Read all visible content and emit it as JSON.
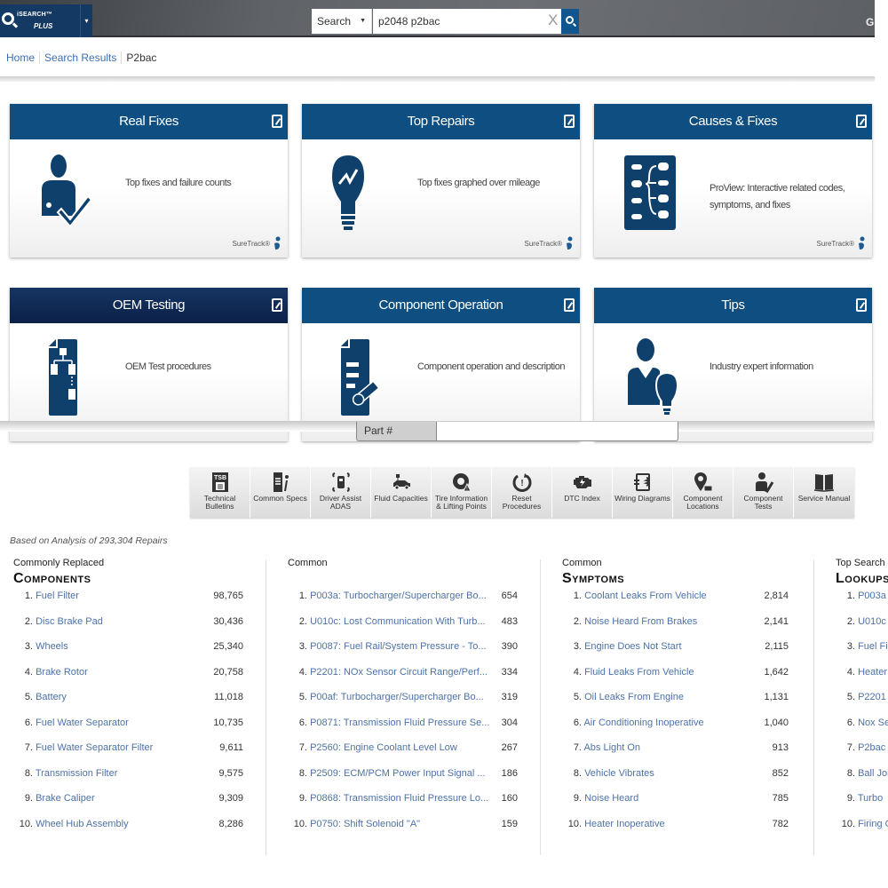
{
  "header": {
    "logo_line1": "iSEARCH™",
    "logo_line2": "PLUS",
    "search_type": "Search",
    "search_query": "p2048 p2bac",
    "clear_glyph": "X",
    "gear_partial": "G"
  },
  "breadcrumb": [
    {
      "label": "Home",
      "link": true
    },
    {
      "label": "Search Results",
      "link": true
    },
    {
      "label": "P2bac",
      "link": false
    }
  ],
  "tiles": [
    {
      "title": "Real Fixes",
      "description": "Top fixes and failure counts",
      "icon": "technician-checkmark-icon",
      "footer": "SureTrack®"
    },
    {
      "title": "Top Repairs",
      "description": "Top fixes graphed over mileage",
      "icon": "lightbulb-graph-icon",
      "footer": "SureTrack®"
    },
    {
      "title": "Causes & Fixes",
      "description": "ProView: Interactive related codes, symptoms, and fixes",
      "icon": "proview-tree-icon",
      "footer": "SureTrack®"
    },
    {
      "title": "OEM Testing",
      "description": "OEM Test procedures",
      "icon": "flowchart-document-icon",
      "footer": ""
    },
    {
      "title": "Component Operation",
      "description": "Component operation and description",
      "icon": "document-part-icon",
      "footer": ""
    },
    {
      "title": "Tips",
      "description": "Industry expert information",
      "icon": "expert-lightbulb-icon",
      "footer": ""
    }
  ],
  "part_search": {
    "label": "Part #",
    "value": ""
  },
  "toolbar": [
    {
      "label": "Technical Bulletins",
      "icon": "tsb-icon"
    },
    {
      "label": "Common Specs",
      "icon": "specs-icon"
    },
    {
      "label": "Driver Assist ADAS",
      "icon": "adas-icon"
    },
    {
      "label": "Fluid Capacities",
      "icon": "fluid-car-icon"
    },
    {
      "label": "Tire Information & Lifting Points",
      "icon": "tire-warning-icon"
    },
    {
      "label": "Reset Procedures",
      "icon": "reset-icon"
    },
    {
      "label": "DTC Index",
      "icon": "engine-icon"
    },
    {
      "label": "Wiring Diagrams",
      "icon": "wiring-icon"
    },
    {
      "label": "Component Locations",
      "icon": "location-pin-icon"
    },
    {
      "label": "Component Tests",
      "icon": "technician-test-icon"
    },
    {
      "label": "Service Manual",
      "icon": "book-icon"
    }
  ],
  "stats": {
    "analysis_text": "Based on Analysis of 293,304 Repairs",
    "components": {
      "subtitle": "Commonly Replaced",
      "title": "Components",
      "items": [
        {
          "rank": "1.",
          "name": "Fuel Filter",
          "count": "98,765"
        },
        {
          "rank": "2.",
          "name": "Disc Brake Pad",
          "count": "30,436"
        },
        {
          "rank": "3.",
          "name": "Wheels",
          "count": "25,340"
        },
        {
          "rank": "4.",
          "name": "Brake Rotor",
          "count": "20,758"
        },
        {
          "rank": "5.",
          "name": "Battery",
          "count": "11,018"
        },
        {
          "rank": "6.",
          "name": "Fuel Water Separator",
          "count": "10,735"
        },
        {
          "rank": "7.",
          "name": "Fuel Water Separator Filter",
          "count": "9,611"
        },
        {
          "rank": "8.",
          "name": "Transmission Filter",
          "count": "9,575"
        },
        {
          "rank": "9.",
          "name": "Brake Caliper",
          "count": "9,309"
        },
        {
          "rank": "10.",
          "name": "Wheel Hub Assembly",
          "count": "8,286"
        }
      ]
    },
    "codes": {
      "subtitle": "Common",
      "title": "",
      "items": [
        {
          "rank": "1.",
          "name": "P003a: Turbocharger/Supercharger Bo...",
          "count": "654"
        },
        {
          "rank": "2.",
          "name": "U010c: Lost Communication With Turb...",
          "count": "483"
        },
        {
          "rank": "3.",
          "name": "P0087: Fuel Rail/System Pressure - To...",
          "count": "390"
        },
        {
          "rank": "4.",
          "name": "P2201: NOx Sensor Circuit Range/Perf...",
          "count": "334"
        },
        {
          "rank": "5.",
          "name": "P00af: Turbocharger/Supercharger Bo...",
          "count": "319"
        },
        {
          "rank": "6.",
          "name": "P0871: Transmission Fluid Pressure Se...",
          "count": "304"
        },
        {
          "rank": "7.",
          "name": "P2560: Engine Coolant Level Low",
          "count": "267"
        },
        {
          "rank": "8.",
          "name": "P2509: ECM/PCM Power Input Signal ...",
          "count": "186"
        },
        {
          "rank": "9.",
          "name": "P0868: Transmission Fluid Pressure Lo...",
          "count": "160"
        },
        {
          "rank": "10.",
          "name": "P0750: Shift Solenoid \"A\"",
          "count": "159"
        }
      ]
    },
    "symptoms": {
      "subtitle": "Common",
      "title": "Symptoms",
      "items": [
        {
          "rank": "1.",
          "name": "Coolant Leaks From Vehicle",
          "count": "2,814"
        },
        {
          "rank": "2.",
          "name": "Noise Heard From Brakes",
          "count": "2,141"
        },
        {
          "rank": "3.",
          "name": "Engine Does Not Start",
          "count": "2,115"
        },
        {
          "rank": "4.",
          "name": "Fluid Leaks From Vehicle",
          "count": "1,642"
        },
        {
          "rank": "5.",
          "name": "Oil Leaks From Engine",
          "count": "1,131"
        },
        {
          "rank": "6.",
          "name": "Air Conditioning Inoperative",
          "count": "1,040"
        },
        {
          "rank": "7.",
          "name": "Abs Light On",
          "count": "913"
        },
        {
          "rank": "8.",
          "name": "Vehicle Vibrates",
          "count": "852"
        },
        {
          "rank": "9.",
          "name": "Noise Heard",
          "count": "785"
        },
        {
          "rank": "10.",
          "name": "Heater Inoperative",
          "count": "782"
        }
      ]
    },
    "lookups": {
      "subtitle": "Top Search",
      "title": "Lookups",
      "items": [
        {
          "rank": "1.",
          "name": "P003a"
        },
        {
          "rank": "2.",
          "name": "U010c"
        },
        {
          "rank": "3.",
          "name": "Fuel Filte"
        },
        {
          "rank": "4.",
          "name": "Heater C"
        },
        {
          "rank": "5.",
          "name": "P2201"
        },
        {
          "rank": "6.",
          "name": "Nox Sen"
        },
        {
          "rank": "7.",
          "name": "P2bac"
        },
        {
          "rank": "8.",
          "name": "Ball Joint"
        },
        {
          "rank": "9.",
          "name": "Turbo"
        },
        {
          "rank": "10.",
          "name": "Firing Or"
        }
      ]
    }
  },
  "colors": {
    "brand_blue": "#0f4e80",
    "brand_dark": "#143a63",
    "link": "#4d72a8"
  }
}
